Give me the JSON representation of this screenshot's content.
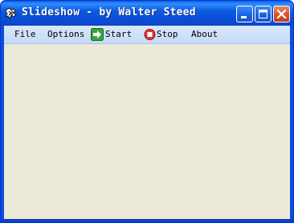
{
  "window": {
    "title": "Slideshow - by Walter Steed",
    "icon": "slideshow-app-icon"
  },
  "title_buttons": {
    "minimize_icon": "minimize-icon",
    "maximize_icon": "maximize-icon",
    "close_icon": "close-icon"
  },
  "menu": {
    "file": "File",
    "options": "Options",
    "start": "Start",
    "stop": "Stop",
    "about": "About"
  },
  "menu_icons": {
    "start": "green-arrow-right-icon",
    "stop": "red-stop-icon"
  },
  "colors": {
    "titlebar": "#0a4fd8",
    "menubar": "#c5dbf7",
    "client": "#ece9d8",
    "close_button": "#d9532b"
  }
}
